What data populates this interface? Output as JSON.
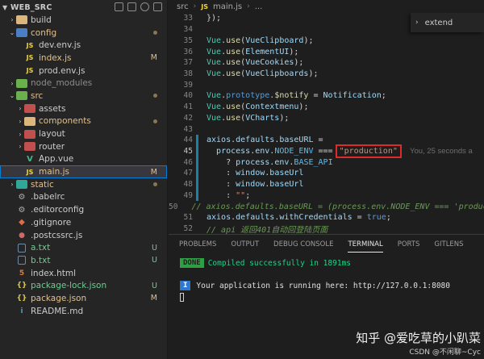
{
  "explorer": {
    "title": "WEB_SRC",
    "items": [
      {
        "label": "build",
        "type": "folder",
        "color": "yellow",
        "expanded": false,
        "state": "ok",
        "badge": ""
      },
      {
        "label": "config",
        "type": "folder",
        "color": "blue",
        "expanded": true,
        "state": "mod",
        "badge": ""
      },
      {
        "label": "dev.env.js",
        "type": "js",
        "state": "ok",
        "badge": ""
      },
      {
        "label": "index.js",
        "type": "js",
        "state": "mod",
        "badge": "M"
      },
      {
        "label": "prod.env.js",
        "type": "js",
        "state": "ok",
        "badge": ""
      },
      {
        "label": "node_modules",
        "type": "folder",
        "color": "green",
        "expanded": false,
        "state": "ignored",
        "badge": ""
      },
      {
        "label": "src",
        "type": "folder",
        "color": "green",
        "expanded": true,
        "state": "mod",
        "badge": ""
      },
      {
        "label": "assets",
        "type": "folder",
        "color": "red",
        "expanded": false,
        "state": "ok",
        "badge": ""
      },
      {
        "label": "components",
        "type": "folder",
        "color": "yellow",
        "expanded": false,
        "state": "mod",
        "badge": ""
      },
      {
        "label": "layout",
        "type": "folder",
        "color": "red",
        "expanded": false,
        "state": "ok",
        "badge": ""
      },
      {
        "label": "router",
        "type": "folder",
        "color": "red",
        "expanded": false,
        "state": "ok",
        "badge": ""
      },
      {
        "label": "App.vue",
        "type": "vue",
        "state": "ok",
        "badge": ""
      },
      {
        "label": "main.js",
        "type": "js",
        "state": "mod",
        "badge": "M"
      },
      {
        "label": "static",
        "type": "folder",
        "color": "teal",
        "expanded": false,
        "state": "mod",
        "badge": ""
      },
      {
        "label": ".babelrc",
        "type": "gear",
        "state": "ok",
        "badge": ""
      },
      {
        "label": ".editorconfig",
        "type": "gear",
        "state": "ok",
        "badge": ""
      },
      {
        "label": ".gitignore",
        "type": "git",
        "state": "ok",
        "badge": ""
      },
      {
        "label": ".postcssrc.js",
        "type": "css",
        "state": "ok",
        "badge": ""
      },
      {
        "label": "a.txt",
        "type": "txt",
        "state": "untracked",
        "badge": "U"
      },
      {
        "label": "b.txt",
        "type": "txt",
        "state": "untracked",
        "badge": "U"
      },
      {
        "label": "index.html",
        "type": "html",
        "state": "ok",
        "badge": ""
      },
      {
        "label": "package-lock.json",
        "type": "json",
        "state": "untracked",
        "badge": "U"
      },
      {
        "label": "package.json",
        "type": "json",
        "state": "mod",
        "badge": "M"
      },
      {
        "label": "README.md",
        "type": "md",
        "state": "ok",
        "badge": ""
      }
    ]
  },
  "editor": {
    "breadcrumb": [
      "src",
      "JS",
      "main.js",
      "..."
    ],
    "extend_label": "extend",
    "lines": [
      {
        "n": "33",
        "html": "});",
        "text": "});"
      },
      {
        "n": "34",
        "text": ""
      },
      {
        "n": "35",
        "text": "Vue.use(VueClipboard);"
      },
      {
        "n": "36",
        "text": "Vue.use(ElementUI);"
      },
      {
        "n": "37",
        "text": "Vue.use(VueCookies);"
      },
      {
        "n": "38",
        "text": "Vue.use(VueClipboards);"
      },
      {
        "n": "39",
        "text": ""
      },
      {
        "n": "40",
        "text": "Vue.prototype.$notify = Notification;"
      },
      {
        "n": "41",
        "text": "Vue.use(Contextmenu);"
      },
      {
        "n": "42",
        "text": "Vue.use(VCharts);"
      },
      {
        "n": "43",
        "text": ""
      },
      {
        "n": "44",
        "text": "axios.defaults.baseURL ="
      },
      {
        "n": "45",
        "text": "process.env.NODE_ENV ===",
        "highlight": "\"production\"",
        "blame": "You, 25 seconds a"
      },
      {
        "n": "46",
        "text": "? process.env.BASE_API"
      },
      {
        "n": "47",
        "text": ": window.baseUrl"
      },
      {
        "n": "48",
        "text": ": window.baseUrl"
      },
      {
        "n": "49",
        "text": ": \"\";"
      },
      {
        "n": "50",
        "text": "// axios.defaults.baseURL = (process.env.NODE_ENV === 'product"
      },
      {
        "n": "51",
        "text": "axios.defaults.withCredentials = true;"
      },
      {
        "n": "52",
        "text": "// api 返回401自动回登陆页面"
      }
    ]
  },
  "panel": {
    "tabs": [
      "PROBLEMS",
      "OUTPUT",
      "DEBUG CONSOLE",
      "TERMINAL",
      "PORTS",
      "GITLENS"
    ],
    "active_tab": "TERMINAL",
    "done_badge": "DONE",
    "compiled_text": "Compiled successfully in 1891ms",
    "info_badge": "I",
    "running_text": "Your application is running here: http://127.0.0.1:8080"
  },
  "watermark": {
    "main": "知乎 @爱吃草的小趴菜",
    "sub": "CSDN @不闲聊~Cyc"
  }
}
